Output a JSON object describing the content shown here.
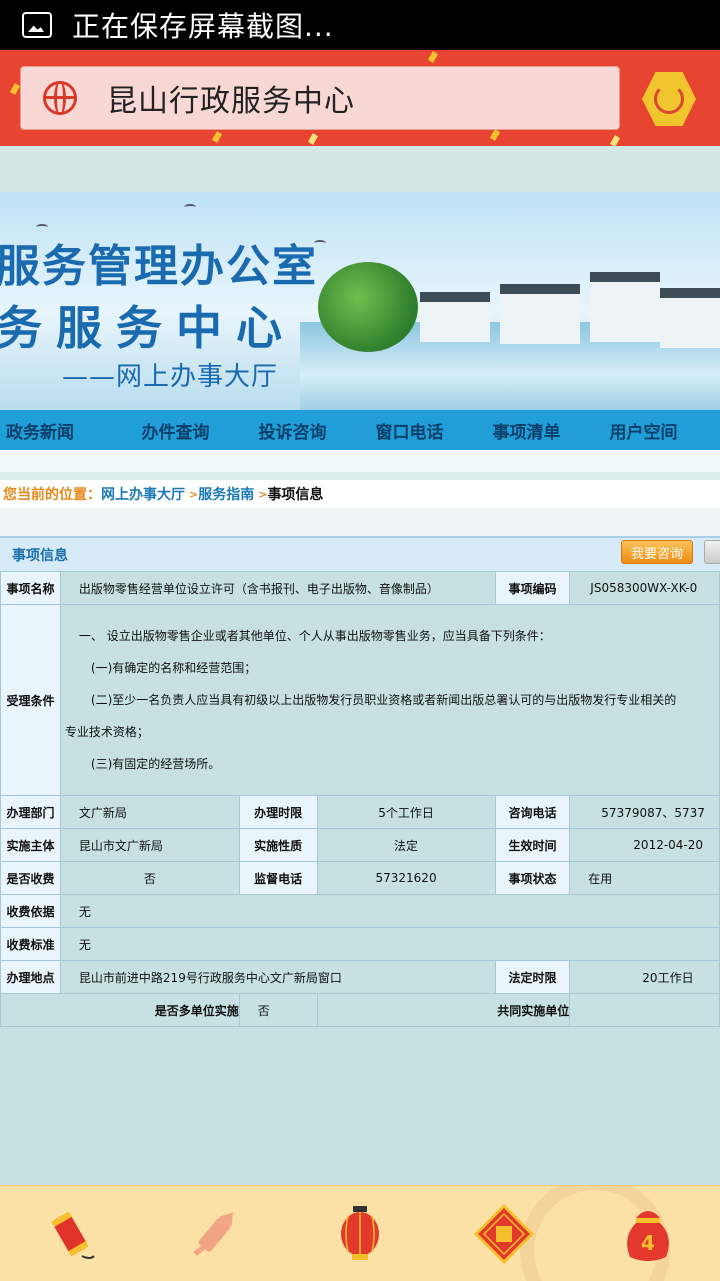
{
  "status_bar": {
    "text": "正在保存屏幕截图..."
  },
  "header": {
    "title": "昆山行政服务中心"
  },
  "banner": {
    "line1": "服务管理办公室",
    "line2": "务服务中心",
    "line3": "——网上办事大厅"
  },
  "nav": [
    {
      "label": "政务新闻"
    },
    {
      "label": "办件查询"
    },
    {
      "label": "投诉咨询"
    },
    {
      "label": "窗口电话"
    },
    {
      "label": "事项清单"
    },
    {
      "label": "用户空间"
    }
  ],
  "breadcrumb": {
    "prefix": "您当前的位置：",
    "hall": "网上办事大厅",
    "sep": ">",
    "guide": "服务指南",
    "current": "事项信息"
  },
  "section": {
    "title": "事项信息",
    "consult_btn": "我要咨询"
  },
  "info": {
    "item_name_label": "事项名称",
    "item_name": "出版物零售经营单位设立许可（含书报刊、电子出版物、音像制品）",
    "item_code_label": "事项编码",
    "item_code": "JS058300WX-XK-0",
    "conditions_label": "受理条件",
    "conditions": [
      "一、 设立出版物零售企业或者其他单位、个人从事出版物零售业务，应当具备下列条件：",
      "(一)有确定的名称和经营范围；",
      "(二)至少一名负责人应当具有初级以上出版物发行员职业资格或者新闻出版总署认可的与出版物发行专业相关的",
      "专业技术资格；",
      "(三)有固定的经营场所。"
    ],
    "dept_label": "办理部门",
    "dept": "文广新局",
    "time_limit_label": "办理时限",
    "time_limit": "5个工作日",
    "phone_label": "咨询电话",
    "phone": "57379087、5737",
    "subject_label": "实施主体",
    "subject": "昆山市文广新局",
    "nature_label": "实施性质",
    "nature": "法定",
    "effective_label": "生效时间",
    "effective": "2012-04-20",
    "charge_label": "是否收费",
    "charge": "否",
    "supervise_label": "监督电话",
    "supervise": "57321620",
    "state_label": "事项状态",
    "state": "在用",
    "basis_label": "收费依据",
    "basis": "无",
    "standard_label": "收费标准",
    "standard": "无",
    "place_label": "办理地点",
    "place": "昆山市前进中路219号行政服务中心文广新局窗口",
    "legal_label": "法定时限",
    "legal": "20工作日",
    "multi_label": "是否多单位实施",
    "multi": "否",
    "joint_label": "共同实施单位",
    "joint": ""
  },
  "bottom_bar": {
    "icons": [
      "firecracker-icon",
      "rocket-firework-icon",
      "lantern-icon",
      "fu-diamond-icon",
      "lucky-bag-icon"
    ],
    "bag_badge": "4"
  }
}
